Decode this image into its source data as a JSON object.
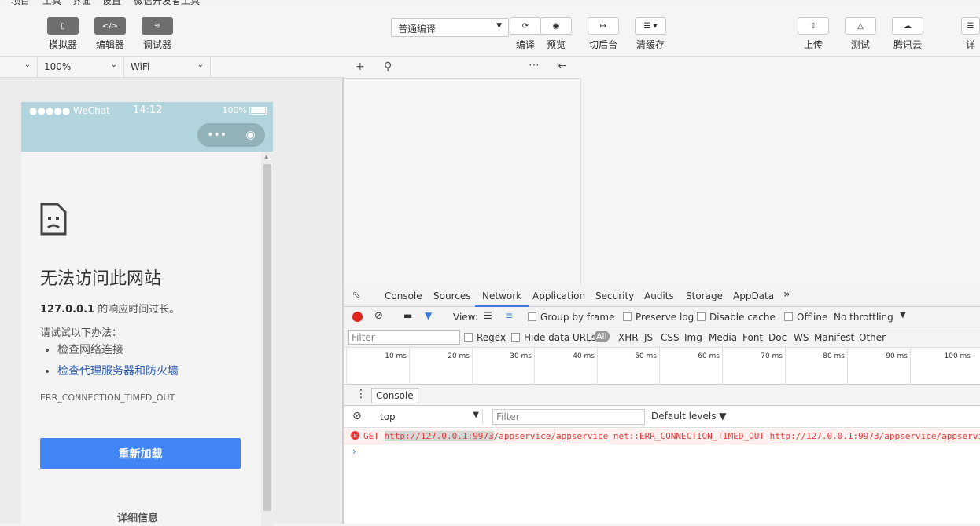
{
  "toolbar": {
    "simulator": "模拟器",
    "editor": "编辑器",
    "debugger": "调试器",
    "compile_mode": "普通编译",
    "compile": "编译",
    "preview": "预览",
    "background": "切后台",
    "clear_cache": "清缓存",
    "upload": "上传",
    "test": "测试",
    "tencent_cloud": "腾讯云",
    "details": "详"
  },
  "subbar": {
    "zoom": "100%",
    "network": "WiFi"
  },
  "phone": {
    "signal": "●●●●● WeChat",
    "time": "14:12",
    "battery": "100%",
    "capsule_more": "•••",
    "error_title": "无法访问此网站",
    "error_host": "127.0.0.1",
    "error_sub": " 的响应时间过长。",
    "try_text": "请试试以下办法：",
    "suggestions": [
      "检查网络连接",
      "检查代理服务器和防火墙"
    ],
    "error_code": "ERR_CONNECTION_TIMED_OUT",
    "reload": "重新加载",
    "details": "详细信息"
  },
  "devtools": {
    "tabs": [
      "Console",
      "Sources",
      "Network",
      "Application",
      "Security",
      "Audits",
      "Storage",
      "AppData"
    ],
    "active_tab": "Network",
    "more": "»",
    "view_label": "View:",
    "group_by_frame": "Group by frame",
    "preserve_log": "Preserve log",
    "disable_cache": "Disable cache",
    "offline": "Offline",
    "throttling": "No throttling",
    "filter_placeholder": "Filter",
    "regex": "Regex",
    "hide_data_urls": "Hide data URLs",
    "all": "All",
    "types": [
      "XHR",
      "JS",
      "CSS",
      "Img",
      "Media",
      "Font",
      "Doc",
      "WS",
      "Manifest",
      "Other"
    ],
    "ticks": [
      "10 ms",
      "20 ms",
      "30 ms",
      "40 ms",
      "50 ms",
      "60 ms",
      "70 ms",
      "80 ms",
      "90 ms",
      "100 ms"
    ],
    "console_tab": "Console",
    "context": "top",
    "console_filter_placeholder": "Filter",
    "levels": "Default levels",
    "error": {
      "method": "GET",
      "url_host": "http://127.0.0.1:9973",
      "url_path": "/appservice/appservice",
      "msg": "net::ERR_CONNECTION_TIMED_OUT",
      "url2": "http://127.0.0.1:9973/appservice/appservi"
    }
  }
}
